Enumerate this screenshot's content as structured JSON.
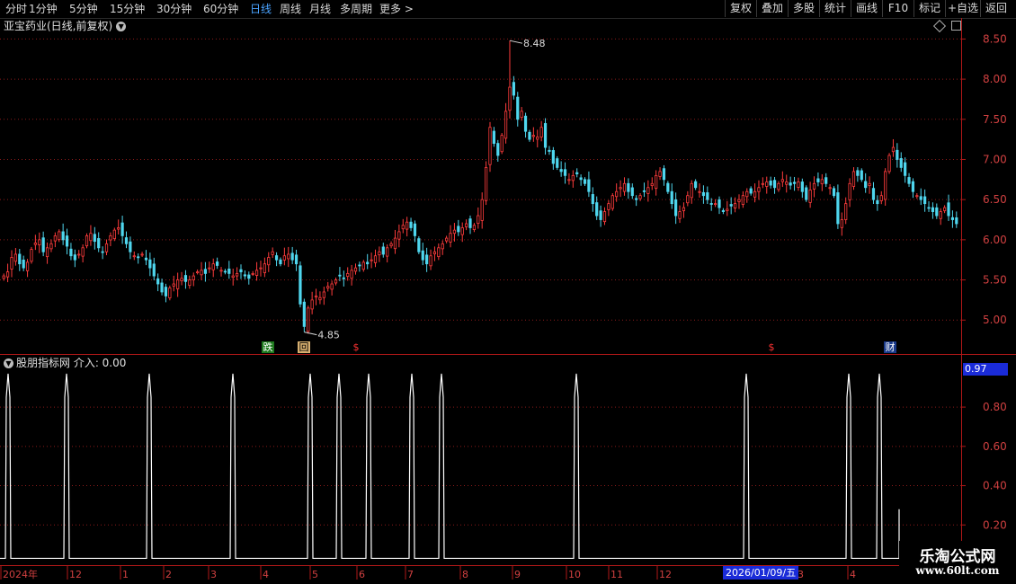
{
  "toolbar": {
    "timeframes": [
      "分时",
      "1分钟",
      "5分钟",
      "15分钟",
      "30分钟",
      "60分钟",
      "日线",
      "周线",
      "月线",
      "多周期",
      "更多 >"
    ],
    "right_buttons": [
      "复权",
      "叠加",
      "多股",
      "统计",
      "画线",
      "F10",
      "标记",
      "+自选",
      "返回"
    ]
  },
  "main_chart": {
    "title": "亚宝药业(日线,前复权)",
    "high_label": "8.48",
    "low_label": "4.85",
    "price_axis": [
      "8.50",
      "8.00",
      "7.50",
      "7.00",
      "6.50",
      "6.00",
      "5.50",
      "5.00"
    ],
    "markers": {
      "die": "跌",
      "hui": "回",
      "dollar": "$",
      "cai": "财"
    }
  },
  "indicator": {
    "title": "股朋指标网 介入: 0.00",
    "current_value": "0.97",
    "axis": [
      "0.80",
      "0.60",
      "0.40",
      "0.20"
    ]
  },
  "time_axis": {
    "labels": [
      "2024年",
      "12",
      "1",
      "2",
      "3",
      "4",
      "5",
      "6",
      "7",
      "8",
      "9",
      "10",
      "11",
      "12",
      "1",
      "3",
      "4"
    ],
    "cursor_date": "2026/01/09/五"
  },
  "watermark": {
    "name": "乐淘公式网",
    "url": "www.60lt.com"
  },
  "colors": {
    "up": "#ff3c3c",
    "down": "#4fd6ee",
    "grid": "#8b1a1a",
    "axis": "#b01818"
  },
  "chart_data": [
    {
      "type": "candlestick",
      "series": [
        {
          "name": "亚宝药业",
          "close": [
            5.55,
            5.6,
            5.78,
            5.82,
            5.7,
            5.65,
            5.72,
            5.88,
            5.96,
            6.0,
            5.85,
            5.9,
            5.95,
            6.05,
            6.1,
            6.0,
            5.92,
            5.8,
            5.75,
            5.82,
            5.9,
            6.05,
            6.08,
            5.98,
            5.9,
            5.85,
            5.95,
            6.05,
            6.12,
            6.15,
            6.05,
            5.95,
            5.85,
            5.8,
            5.78,
            5.82,
            5.75,
            5.65,
            5.55,
            5.45,
            5.35,
            5.3,
            5.4,
            5.45,
            5.5,
            5.52,
            5.48,
            5.5,
            5.55,
            5.6,
            5.62,
            5.58,
            5.65,
            5.7,
            5.68,
            5.62,
            5.6,
            5.58,
            5.55,
            5.58,
            5.6,
            5.55,
            5.52,
            5.58,
            5.62,
            5.65,
            5.7,
            5.78,
            5.85,
            5.75,
            5.7,
            5.8,
            5.82,
            5.75,
            5.7,
            5.2,
            4.92,
            5.15,
            5.25,
            5.3,
            5.28,
            5.35,
            5.42,
            5.45,
            5.5,
            5.55,
            5.52,
            5.58,
            5.62,
            5.65,
            5.68,
            5.72,
            5.7,
            5.75,
            5.8,
            5.85,
            5.82,
            5.9,
            5.95,
            6.02,
            6.1,
            6.18,
            6.22,
            6.15,
            6.05,
            5.85,
            5.75,
            5.7,
            5.8,
            5.85,
            5.9,
            5.95,
            6.02,
            6.08,
            6.12,
            6.1,
            6.15,
            6.2,
            6.15,
            6.18,
            6.3,
            6.5,
            6.9,
            7.4,
            7.2,
            7.05,
            7.3,
            7.6,
            7.9,
            7.8,
            7.5,
            7.6,
            7.35,
            7.25,
            7.3,
            7.28,
            7.4,
            7.15,
            7.1,
            6.95,
            6.9,
            6.85,
            6.8,
            6.75,
            6.8,
            6.82,
            6.75,
            6.7,
            6.6,
            6.45,
            6.3,
            6.25,
            6.35,
            6.45,
            6.55,
            6.6,
            6.65,
            6.7,
            6.6,
            6.55,
            6.5,
            6.55,
            6.6,
            6.65,
            6.7,
            6.8,
            6.85,
            6.75,
            6.6,
            6.45,
            6.3,
            6.35,
            6.4,
            6.55,
            6.7,
            6.65,
            6.6,
            6.55,
            6.5,
            6.45,
            6.45,
            6.4,
            6.35,
            6.38,
            6.42,
            6.45,
            6.5,
            6.55,
            6.6,
            6.58,
            6.6,
            6.65,
            6.7,
            6.72,
            6.68,
            6.65,
            6.7,
            6.75,
            6.72,
            6.68,
            6.7,
            6.72,
            6.6,
            6.5,
            6.62,
            6.7,
            6.72,
            6.75,
            6.7,
            6.65,
            6.55,
            6.2,
            6.25,
            6.45,
            6.7,
            6.85,
            6.8,
            6.75,
            6.65,
            6.7,
            6.5,
            6.45,
            6.55,
            6.85,
            7.05,
            7.15,
            7.0,
            6.9,
            6.8,
            6.7,
            6.6,
            6.55,
            6.5,
            6.45,
            6.4,
            6.35,
            6.3,
            6.35,
            6.4,
            6.3,
            6.25,
            6.2
          ]
        }
      ],
      "ylim": [
        4.6,
        8.65
      ],
      "high": 8.48,
      "low": 4.85
    },
    {
      "type": "line",
      "series": [
        {
          "name": "介入",
          "values": [
            0.97,
            0.97,
            0.97,
            0.97,
            0.97,
            0.97,
            0.97,
            0.97,
            0.97,
            0.97,
            0.97,
            0.97,
            0.97,
            0.97
          ]
        }
      ],
      "spike_months_index": [
        0,
        1,
        2,
        3,
        4,
        5,
        6,
        7,
        8,
        9,
        10,
        11,
        12,
        13
      ],
      "ylim": [
        0,
        1.02
      ]
    }
  ]
}
